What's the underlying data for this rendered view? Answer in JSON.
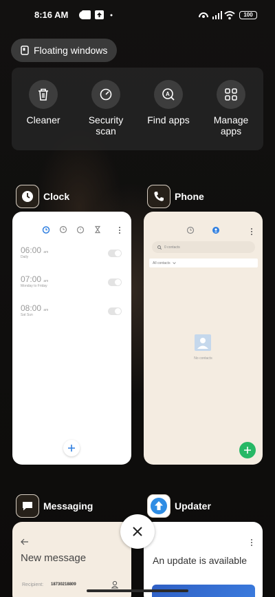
{
  "status_bar": {
    "time": "8:16 AM",
    "battery": "100"
  },
  "floating_windows": {
    "label": "Floating windows"
  },
  "tools": [
    {
      "label": "Cleaner",
      "icon": "trash-icon"
    },
    {
      "label": "Security scan",
      "icon": "shield-gauge-icon"
    },
    {
      "label": "Find apps",
      "icon": "find-apps-icon"
    },
    {
      "label": "Manage apps",
      "icon": "grid-icon"
    }
  ],
  "apps": {
    "clock": {
      "name": "Clock",
      "alarms": [
        {
          "time": "06:00",
          "ampm": "am",
          "repeat": "Daily"
        },
        {
          "time": "07:00",
          "ampm": "am",
          "repeat": "Monday to Friday"
        },
        {
          "time": "08:00",
          "ampm": "am",
          "repeat": "Sat Sun"
        }
      ]
    },
    "phone": {
      "name": "Phone",
      "search_placeholder": "0 contacts",
      "filter": "All contacts",
      "empty": "No contacts"
    },
    "messaging": {
      "name": "Messaging",
      "title": "New message",
      "recipient_label": "Recipient:",
      "recipient_value": "18730218809"
    },
    "updater": {
      "name": "Updater",
      "title": "An update is available"
    }
  },
  "colors": {
    "accent_blue": "#2f7fe0",
    "phone_green": "#27b866",
    "card_beige": "#f4ece1"
  }
}
